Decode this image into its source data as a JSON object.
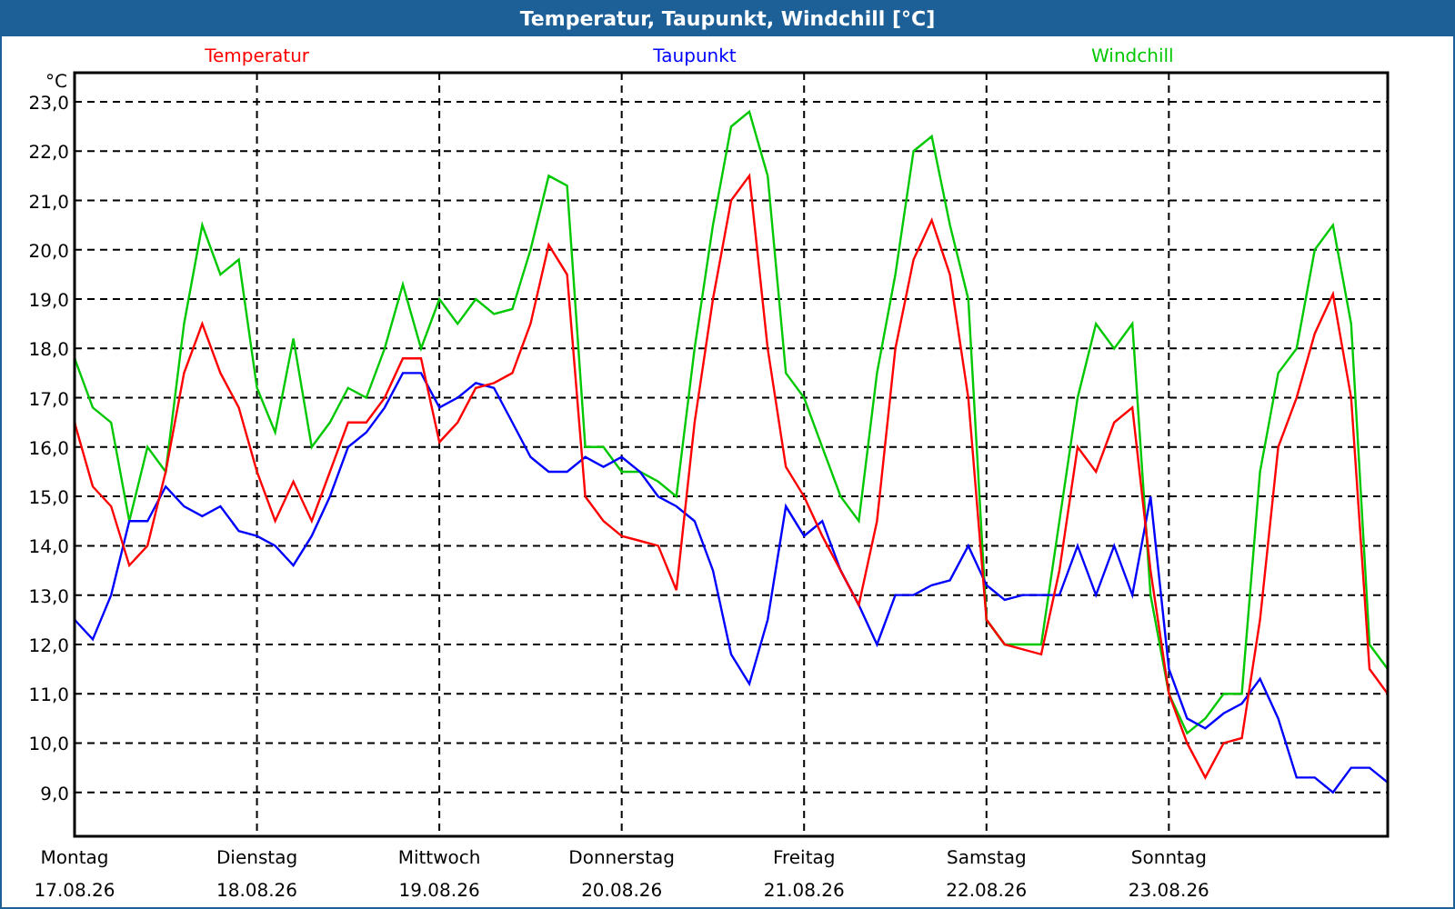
{
  "window": {
    "title": "Temperatur, Taupunkt, Windchill [°C]"
  },
  "chart": {
    "chart_data": {
      "type": "line",
      "ylabel": "°C",
      "categories": [
        "Montag",
        null,
        null,
        null,
        null,
        null,
        null,
        null,
        null,
        null,
        "Dienstag",
        null,
        null,
        null,
        null,
        null,
        null,
        null,
        null,
        null,
        "Mittwoch",
        null,
        null,
        null,
        null,
        null,
        null,
        null,
        null,
        null,
        "Donnerstag",
        null,
        null,
        null,
        null,
        null,
        null,
        null,
        null,
        null,
        "Freitag",
        null,
        null,
        null,
        null,
        null,
        null,
        null,
        null,
        null,
        "Samstag",
        null,
        null,
        null,
        null,
        null,
        null,
        null,
        null,
        null,
        "Sonntag",
        null,
        null,
        null,
        null,
        null,
        null,
        null,
        null,
        null,
        null,
        null,
        null
      ],
      "series": [
        {
          "name": "Temperatur",
          "color": "#ff0000",
          "values": [
            16.5,
            15.2,
            14.8,
            13.6,
            14.0,
            15.5,
            17.5,
            18.5,
            17.5,
            16.8,
            15.5,
            14.5,
            15.3,
            14.5,
            15.5,
            16.5,
            16.5,
            17.0,
            17.8,
            17.8,
            16.1,
            16.5,
            17.2,
            17.3,
            17.5,
            18.5,
            20.1,
            19.5,
            15.0,
            14.5,
            14.2,
            14.1,
            14.0,
            13.1,
            16.5,
            19.0,
            21.0,
            21.5,
            18.0,
            15.6,
            15.0,
            14.2,
            13.5,
            12.8,
            14.5,
            18.0,
            19.8,
            20.6,
            19.5,
            17.0,
            12.5,
            12.0,
            11.9,
            11.8,
            13.5,
            16.0,
            15.5,
            16.5,
            16.8,
            13.5,
            11.0,
            10.0,
            9.3,
            10.0,
            10.1,
            12.5,
            16.0,
            17.0,
            18.3,
            19.1,
            17.0,
            11.5,
            11.0
          ]
        },
        {
          "name": "Taupunkt",
          "color": "#0000ff",
          "values": [
            12.5,
            12.1,
            13.0,
            14.5,
            14.5,
            15.2,
            14.8,
            14.6,
            14.8,
            14.3,
            14.2,
            14.0,
            13.6,
            14.2,
            15.0,
            16.0,
            16.3,
            16.8,
            17.5,
            17.5,
            16.8,
            17.0,
            17.3,
            17.2,
            16.5,
            15.8,
            15.5,
            15.5,
            15.8,
            15.6,
            15.8,
            15.5,
            15.0,
            14.8,
            14.5,
            13.5,
            11.8,
            11.2,
            12.5,
            14.8,
            14.2,
            14.5,
            13.5,
            12.8,
            12.0,
            13.0,
            13.0,
            13.2,
            13.3,
            14.0,
            13.2,
            12.9,
            13.0,
            13.0,
            13.0,
            14.0,
            13.0,
            14.0,
            13.0,
            15.0,
            11.5,
            10.5,
            10.3,
            10.6,
            10.8,
            11.3,
            10.5,
            9.3,
            9.3,
            9.0,
            9.5,
            9.5,
            9.2
          ]
        },
        {
          "name": "Windchill",
          "color": "#00c800",
          "values": [
            17.8,
            16.8,
            16.5,
            14.5,
            16.0,
            15.5,
            18.5,
            20.5,
            19.5,
            19.8,
            17.2,
            16.3,
            18.2,
            16.0,
            16.5,
            17.2,
            17.0,
            18.0,
            19.3,
            18.0,
            19.0,
            18.5,
            19.0,
            18.7,
            18.8,
            20.0,
            21.5,
            21.3,
            16.0,
            16.0,
            15.5,
            15.5,
            15.3,
            15.0,
            18.0,
            20.5,
            22.5,
            22.8,
            21.5,
            17.5,
            17.0,
            16.0,
            15.0,
            14.5,
            17.5,
            19.5,
            22.0,
            22.3,
            20.5,
            19.0,
            12.5,
            12.0,
            12.0,
            12.0,
            14.5,
            17.0,
            18.5,
            18.0,
            18.5,
            13.0,
            11.0,
            10.2,
            10.5,
            11.0,
            11.0,
            15.5,
            17.5,
            18.0,
            20.0,
            20.5,
            18.5,
            12.0,
            11.5
          ]
        }
      ],
      "ylim": [
        8.11,
        23.59
      ],
      "grid": true,
      "yticks": [
        {
          "value": 9,
          "label": "9,0"
        },
        {
          "value": 10,
          "label": "10,0"
        },
        {
          "value": 11,
          "label": "11,0"
        },
        {
          "value": 12,
          "label": "12,0"
        },
        {
          "value": 13,
          "label": "13,0"
        },
        {
          "value": 14,
          "label": "14,0"
        },
        {
          "value": 15,
          "label": "15,0"
        },
        {
          "value": 16,
          "label": "16,0"
        },
        {
          "value": 17,
          "label": "17,0"
        },
        {
          "value": 18,
          "label": "18,0"
        },
        {
          "value": 19,
          "label": "19,0"
        },
        {
          "value": 20,
          "label": "20,0"
        },
        {
          "value": 21,
          "label": "21,0"
        },
        {
          "value": 22,
          "label": "22,0"
        },
        {
          "value": 23,
          "label": "23,0"
        }
      ]
    },
    "dates": [
      "17.08.26",
      "18.08.26",
      "19.08.26",
      "20.08.26",
      "21.08.26",
      "22.08.26",
      "23.08.26"
    ]
  }
}
